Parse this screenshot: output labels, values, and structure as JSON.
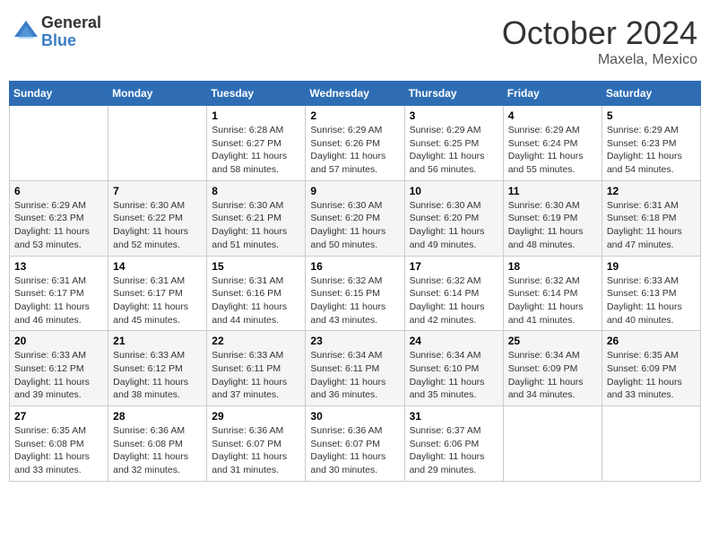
{
  "logo": {
    "general": "General",
    "blue": "Blue"
  },
  "title": "October 2024",
  "location": "Maxela, Mexico",
  "days_of_week": [
    "Sunday",
    "Monday",
    "Tuesday",
    "Wednesday",
    "Thursday",
    "Friday",
    "Saturday"
  ],
  "weeks": [
    [
      {
        "day": "",
        "sunrise": "",
        "sunset": "",
        "daylight": ""
      },
      {
        "day": "",
        "sunrise": "",
        "sunset": "",
        "daylight": ""
      },
      {
        "day": "1",
        "sunrise": "Sunrise: 6:28 AM",
        "sunset": "Sunset: 6:27 PM",
        "daylight": "Daylight: 11 hours and 58 minutes."
      },
      {
        "day": "2",
        "sunrise": "Sunrise: 6:29 AM",
        "sunset": "Sunset: 6:26 PM",
        "daylight": "Daylight: 11 hours and 57 minutes."
      },
      {
        "day": "3",
        "sunrise": "Sunrise: 6:29 AM",
        "sunset": "Sunset: 6:25 PM",
        "daylight": "Daylight: 11 hours and 56 minutes."
      },
      {
        "day": "4",
        "sunrise": "Sunrise: 6:29 AM",
        "sunset": "Sunset: 6:24 PM",
        "daylight": "Daylight: 11 hours and 55 minutes."
      },
      {
        "day": "5",
        "sunrise": "Sunrise: 6:29 AM",
        "sunset": "Sunset: 6:23 PM",
        "daylight": "Daylight: 11 hours and 54 minutes."
      }
    ],
    [
      {
        "day": "6",
        "sunrise": "Sunrise: 6:29 AM",
        "sunset": "Sunset: 6:23 PM",
        "daylight": "Daylight: 11 hours and 53 minutes."
      },
      {
        "day": "7",
        "sunrise": "Sunrise: 6:30 AM",
        "sunset": "Sunset: 6:22 PM",
        "daylight": "Daylight: 11 hours and 52 minutes."
      },
      {
        "day": "8",
        "sunrise": "Sunrise: 6:30 AM",
        "sunset": "Sunset: 6:21 PM",
        "daylight": "Daylight: 11 hours and 51 minutes."
      },
      {
        "day": "9",
        "sunrise": "Sunrise: 6:30 AM",
        "sunset": "Sunset: 6:20 PM",
        "daylight": "Daylight: 11 hours and 50 minutes."
      },
      {
        "day": "10",
        "sunrise": "Sunrise: 6:30 AM",
        "sunset": "Sunset: 6:20 PM",
        "daylight": "Daylight: 11 hours and 49 minutes."
      },
      {
        "day": "11",
        "sunrise": "Sunrise: 6:30 AM",
        "sunset": "Sunset: 6:19 PM",
        "daylight": "Daylight: 11 hours and 48 minutes."
      },
      {
        "day": "12",
        "sunrise": "Sunrise: 6:31 AM",
        "sunset": "Sunset: 6:18 PM",
        "daylight": "Daylight: 11 hours and 47 minutes."
      }
    ],
    [
      {
        "day": "13",
        "sunrise": "Sunrise: 6:31 AM",
        "sunset": "Sunset: 6:17 PM",
        "daylight": "Daylight: 11 hours and 46 minutes."
      },
      {
        "day": "14",
        "sunrise": "Sunrise: 6:31 AM",
        "sunset": "Sunset: 6:17 PM",
        "daylight": "Daylight: 11 hours and 45 minutes."
      },
      {
        "day": "15",
        "sunrise": "Sunrise: 6:31 AM",
        "sunset": "Sunset: 6:16 PM",
        "daylight": "Daylight: 11 hours and 44 minutes."
      },
      {
        "day": "16",
        "sunrise": "Sunrise: 6:32 AM",
        "sunset": "Sunset: 6:15 PM",
        "daylight": "Daylight: 11 hours and 43 minutes."
      },
      {
        "day": "17",
        "sunrise": "Sunrise: 6:32 AM",
        "sunset": "Sunset: 6:14 PM",
        "daylight": "Daylight: 11 hours and 42 minutes."
      },
      {
        "day": "18",
        "sunrise": "Sunrise: 6:32 AM",
        "sunset": "Sunset: 6:14 PM",
        "daylight": "Daylight: 11 hours and 41 minutes."
      },
      {
        "day": "19",
        "sunrise": "Sunrise: 6:33 AM",
        "sunset": "Sunset: 6:13 PM",
        "daylight": "Daylight: 11 hours and 40 minutes."
      }
    ],
    [
      {
        "day": "20",
        "sunrise": "Sunrise: 6:33 AM",
        "sunset": "Sunset: 6:12 PM",
        "daylight": "Daylight: 11 hours and 39 minutes."
      },
      {
        "day": "21",
        "sunrise": "Sunrise: 6:33 AM",
        "sunset": "Sunset: 6:12 PM",
        "daylight": "Daylight: 11 hours and 38 minutes."
      },
      {
        "day": "22",
        "sunrise": "Sunrise: 6:33 AM",
        "sunset": "Sunset: 6:11 PM",
        "daylight": "Daylight: 11 hours and 37 minutes."
      },
      {
        "day": "23",
        "sunrise": "Sunrise: 6:34 AM",
        "sunset": "Sunset: 6:11 PM",
        "daylight": "Daylight: 11 hours and 36 minutes."
      },
      {
        "day": "24",
        "sunrise": "Sunrise: 6:34 AM",
        "sunset": "Sunset: 6:10 PM",
        "daylight": "Daylight: 11 hours and 35 minutes."
      },
      {
        "day": "25",
        "sunrise": "Sunrise: 6:34 AM",
        "sunset": "Sunset: 6:09 PM",
        "daylight": "Daylight: 11 hours and 34 minutes."
      },
      {
        "day": "26",
        "sunrise": "Sunrise: 6:35 AM",
        "sunset": "Sunset: 6:09 PM",
        "daylight": "Daylight: 11 hours and 33 minutes."
      }
    ],
    [
      {
        "day": "27",
        "sunrise": "Sunrise: 6:35 AM",
        "sunset": "Sunset: 6:08 PM",
        "daylight": "Daylight: 11 hours and 33 minutes."
      },
      {
        "day": "28",
        "sunrise": "Sunrise: 6:36 AM",
        "sunset": "Sunset: 6:08 PM",
        "daylight": "Daylight: 11 hours and 32 minutes."
      },
      {
        "day": "29",
        "sunrise": "Sunrise: 6:36 AM",
        "sunset": "Sunset: 6:07 PM",
        "daylight": "Daylight: 11 hours and 31 minutes."
      },
      {
        "day": "30",
        "sunrise": "Sunrise: 6:36 AM",
        "sunset": "Sunset: 6:07 PM",
        "daylight": "Daylight: 11 hours and 30 minutes."
      },
      {
        "day": "31",
        "sunrise": "Sunrise: 6:37 AM",
        "sunset": "Sunset: 6:06 PM",
        "daylight": "Daylight: 11 hours and 29 minutes."
      },
      {
        "day": "",
        "sunrise": "",
        "sunset": "",
        "daylight": ""
      },
      {
        "day": "",
        "sunrise": "",
        "sunset": "",
        "daylight": ""
      }
    ]
  ]
}
